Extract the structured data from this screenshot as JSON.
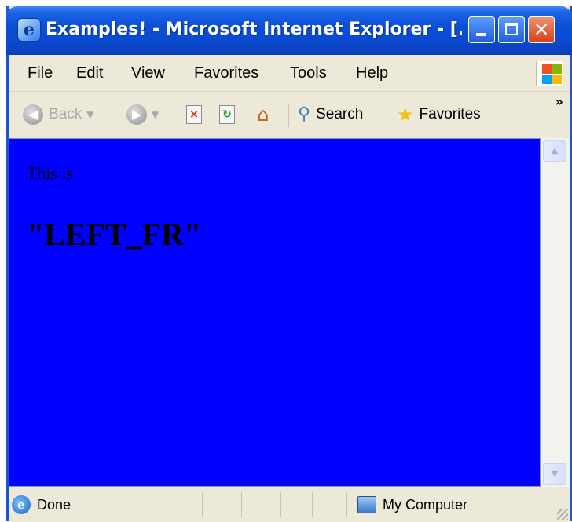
{
  "window": {
    "title": "Examples! - Microsoft Internet Explorer - [..."
  },
  "menu": {
    "items": [
      "File",
      "Edit",
      "View",
      "Favorites",
      "Tools",
      "Help"
    ]
  },
  "toolbar": {
    "back_label": "Back",
    "search_label": "Search",
    "favorites_label": "Favorites",
    "overflow": "»"
  },
  "page": {
    "line1": "This is",
    "heading": "\"LEFT_FR\"",
    "background_color": "#0000ff"
  },
  "status": {
    "left_text": "Done",
    "zone_text": "My Computer"
  },
  "colors": {
    "titlebar": "#0a4fd7",
    "chrome": "#ece9d8"
  }
}
